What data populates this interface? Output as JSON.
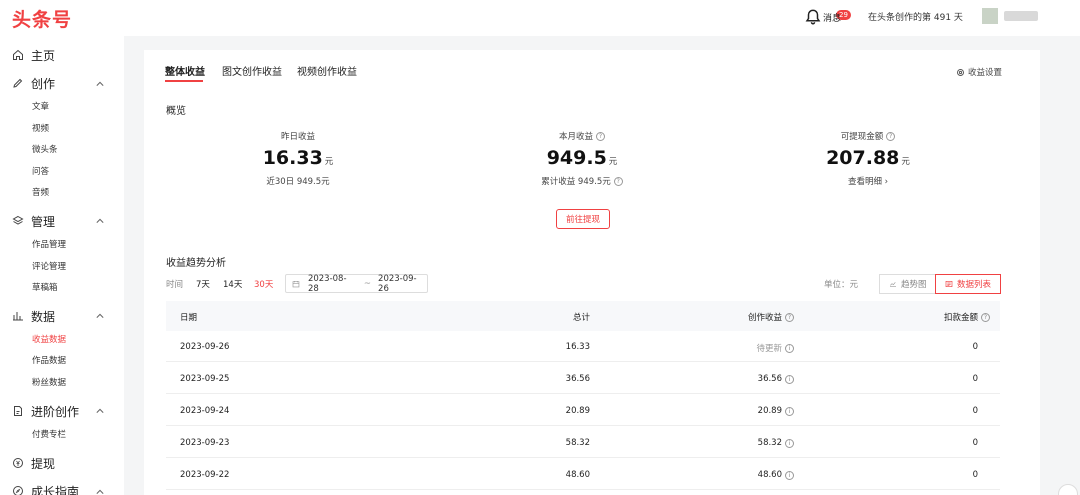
{
  "app": {
    "logo": "头条号"
  },
  "header": {
    "notification_badge": "29",
    "notification_label": "消息",
    "days_text": "在头条创作的第 491 天"
  },
  "sidebar": {
    "home": "主页",
    "create": {
      "label": "创作",
      "items": [
        "文章",
        "视频",
        "微头条",
        "问答",
        "音频"
      ]
    },
    "manage": {
      "label": "管理",
      "items": [
        "作品管理",
        "评论管理",
        "草稿箱"
      ]
    },
    "data": {
      "label": "数据",
      "items": [
        "收益数据",
        "作品数据",
        "粉丝数据"
      ]
    },
    "advanced": {
      "label": "进阶创作",
      "items": [
        "付费专栏"
      ]
    },
    "withdraw": "提现",
    "growth": "成长指南"
  },
  "tabs": [
    "整体收益",
    "图文创作收益",
    "视频创作收益"
  ],
  "settings_label": "收益设置",
  "overview": {
    "title": "概览",
    "metrics": [
      {
        "label": "昨日收益",
        "value": "16.33",
        "unit": "元",
        "sub": "近30日 949.5元"
      },
      {
        "label": "本月收益",
        "value": "949.5",
        "unit": "元",
        "sub": "累计收益 949.5元"
      },
      {
        "label": "可提现金额",
        "value": "207.88",
        "unit": "元",
        "sub": "查看明细 ›"
      }
    ],
    "withdraw_button": "前往提现"
  },
  "trend": {
    "title": "收益趋势分析",
    "time_label": "时间",
    "ranges": [
      "7天",
      "14天",
      "30天"
    ],
    "active_range": "30天",
    "date_start": "2023-08-28",
    "date_end": "2023-09-26",
    "tilde": "~",
    "unit_label": "单位：元",
    "view_chart": "趋势图",
    "view_list": "数据列表"
  },
  "table": {
    "headers": {
      "date": "日期",
      "total": "总计",
      "creation": "创作收益",
      "deduction": "扣款金额"
    },
    "rows": [
      {
        "date": "2023-09-26",
        "total": "16.33",
        "creation": "待更新",
        "deduction": "0"
      },
      {
        "date": "2023-09-25",
        "total": "36.56",
        "creation": "36.56",
        "deduction": "0"
      },
      {
        "date": "2023-09-24",
        "total": "20.89",
        "creation": "20.89",
        "deduction": "0"
      },
      {
        "date": "2023-09-23",
        "total": "58.32",
        "creation": "58.32",
        "deduction": "0"
      },
      {
        "date": "2023-09-22",
        "total": "48.60",
        "creation": "48.60",
        "deduction": "0"
      }
    ]
  },
  "colors": {
    "accent": "#f04142",
    "muted": "#888888"
  }
}
